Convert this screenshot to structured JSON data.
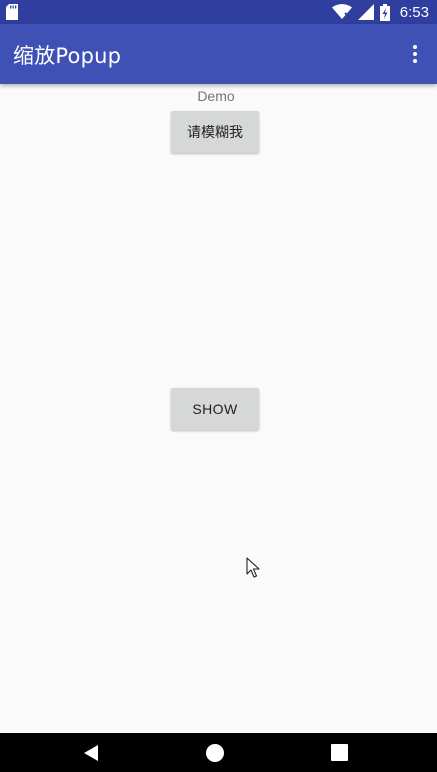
{
  "status_bar": {
    "time": "6:53",
    "icons": [
      "sd-card-icon",
      "wifi-icon",
      "cell-signal-icon",
      "battery-icon"
    ]
  },
  "app_bar": {
    "title": "缩放Popup",
    "overflow_icon": "more-vert-icon",
    "color": "#3F51B5"
  },
  "main": {
    "demo_label": "Demo",
    "blur_button_label": "请模糊我",
    "show_button_label": "SHOW"
  },
  "nav_bar": {
    "icons": [
      "back-icon",
      "home-icon",
      "recents-icon"
    ]
  },
  "colors": {
    "status_bar": "#303F9F",
    "app_bar": "#3F51B5",
    "background": "#fafafa",
    "button": "#d6d7d7"
  }
}
